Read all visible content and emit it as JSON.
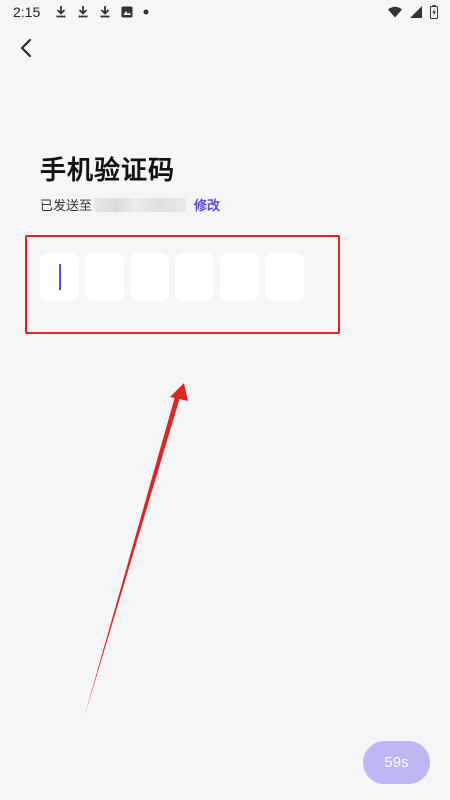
{
  "status_bar": {
    "time": "2:15",
    "left_icons": [
      "download-icon",
      "download-icon",
      "download-icon",
      "photo-icon",
      "dot-icon"
    ],
    "right_icons": [
      "wifi-icon",
      "signal-icon",
      "battery-charging-icon"
    ]
  },
  "nav": {
    "back_icon": "chevron-left-icon"
  },
  "page": {
    "title": "手机验证码",
    "sent_prefix": "已发送至",
    "edit_label": "修改"
  },
  "code_input": {
    "length": 6,
    "values": [
      "",
      "",
      "",
      "",
      "",
      ""
    ],
    "active_index": 0
  },
  "countdown": {
    "label": "59s"
  },
  "colors": {
    "accent": "#5b4dd8",
    "countdown_bg": "#bcb6f2",
    "annotation": "#e02424",
    "background": "#f6f6f8"
  }
}
